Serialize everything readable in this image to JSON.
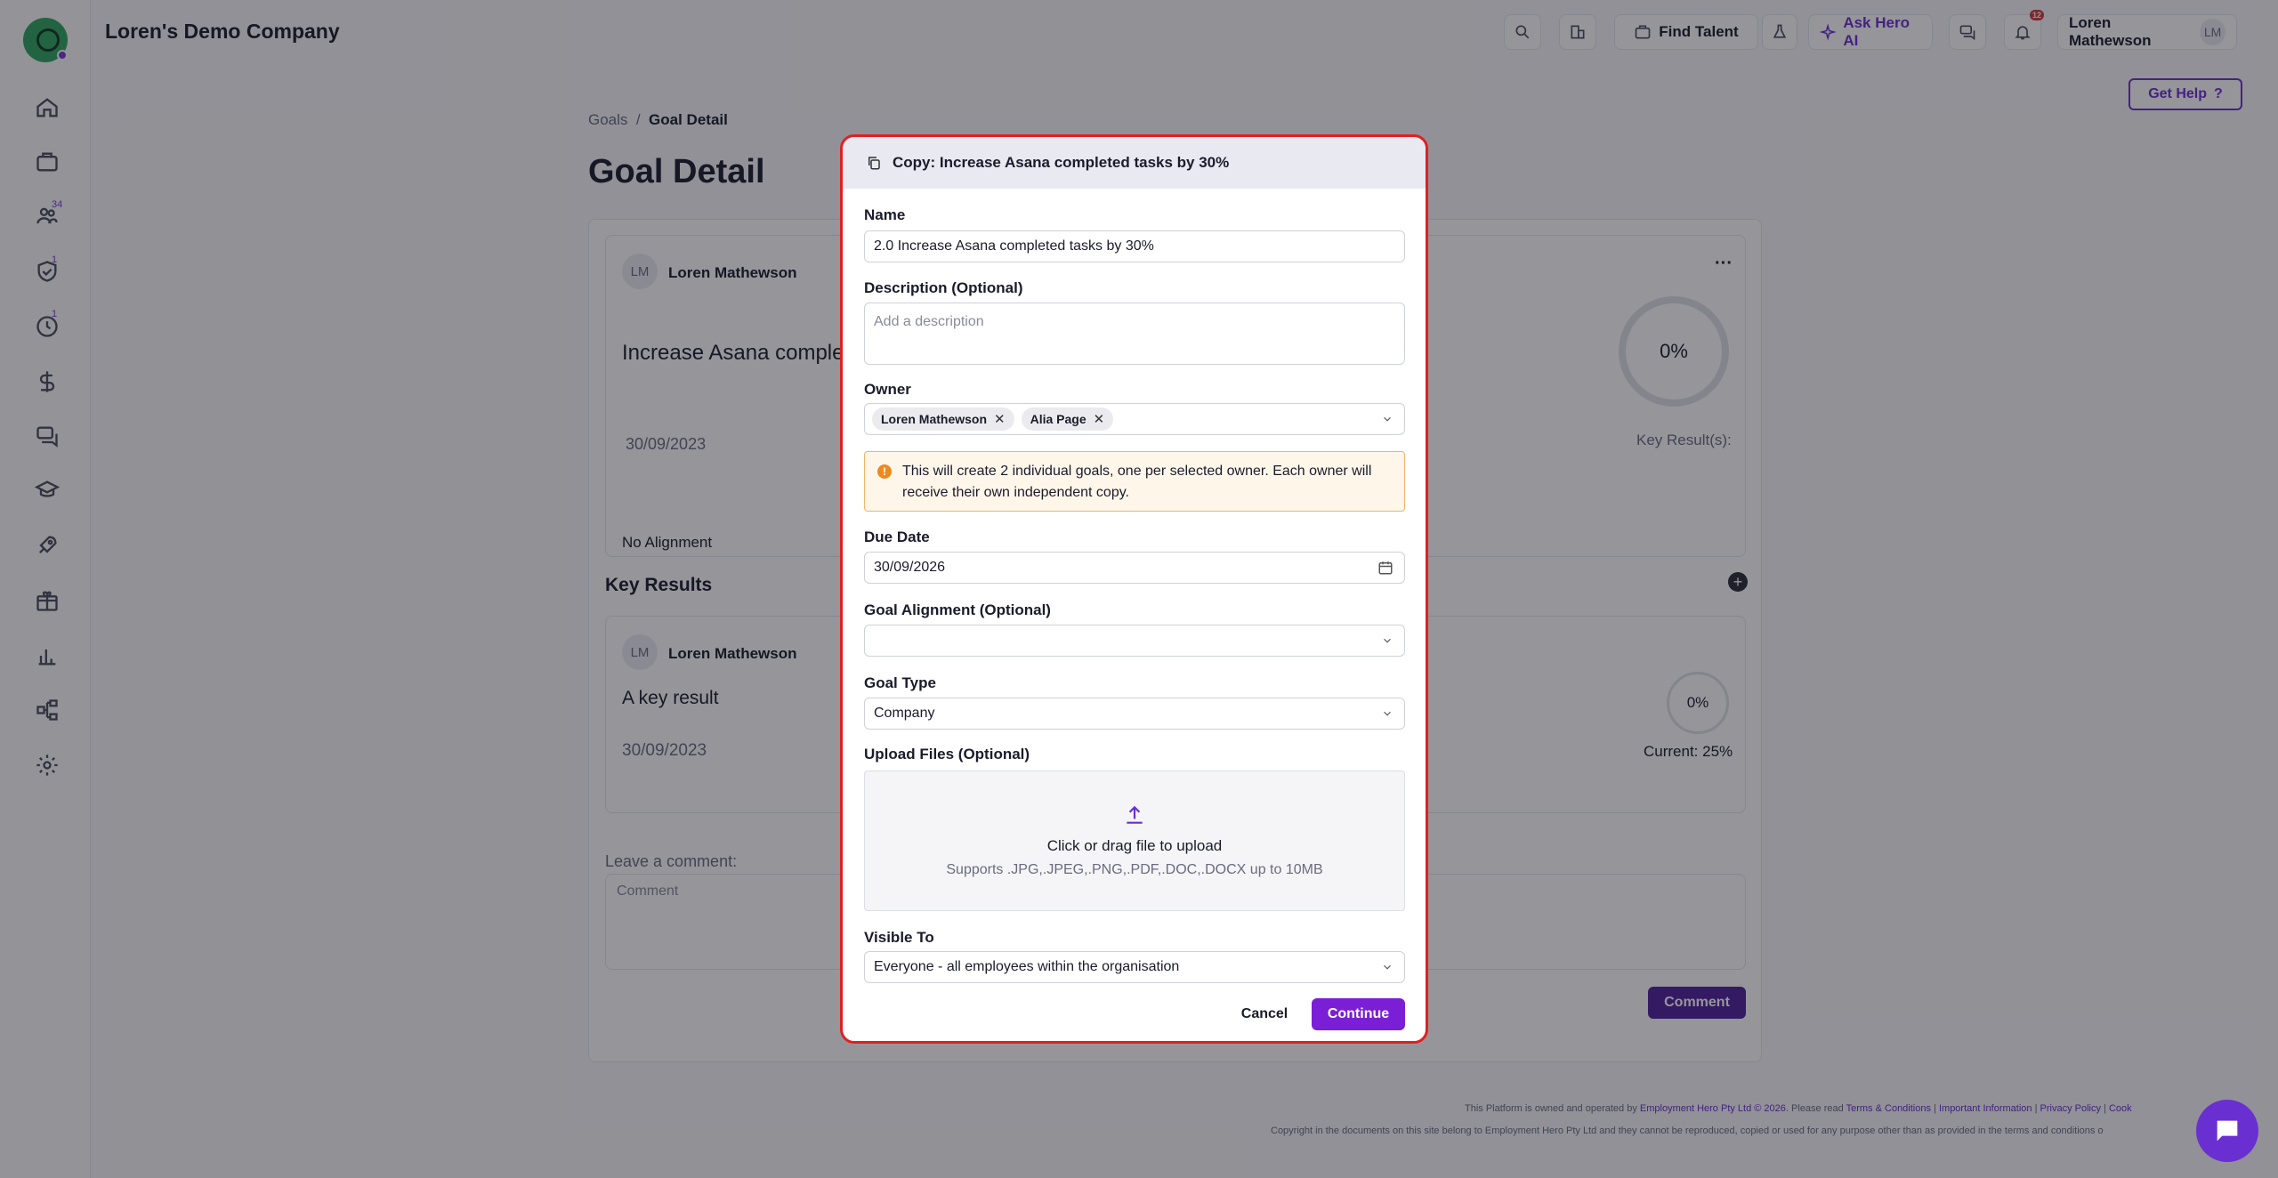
{
  "header": {
    "company": "Loren's Demo Company",
    "find_talent": "Find Talent",
    "ask_ai": "Ask Hero AI",
    "user_name": "Loren Mathewson",
    "user_initials": "LM",
    "notification_count": "12",
    "get_help": "Get Help"
  },
  "sidebar": {
    "badges": {
      "people": "34",
      "compliance": "1",
      "time": "1"
    }
  },
  "page": {
    "breadcrumb_parent": "Goals",
    "breadcrumb_current": "Goal Detail",
    "title": "Goal Detail",
    "goal_owner": "Loren Mathewson",
    "goal_title": "Increase Asana comple",
    "goal_due": "30/09/2023",
    "goal_progress": "0%",
    "key_results_label": "Key Result(s):",
    "alignment": "No Alignment",
    "kr_section": "Key Results",
    "kr_owner": "Loren Mathewson",
    "kr_title": "A key result",
    "kr_due": "30/09/2023",
    "kr_progress": "0%",
    "kr_current": "Current: 25%",
    "comment_label": "Leave a comment:",
    "comment_placeholder": "Comment",
    "comment_button": "Comment"
  },
  "modal": {
    "title": "Copy: Increase Asana completed tasks by 30%",
    "name_label": "Name",
    "name_value": "2.0 Increase Asana completed tasks by 30%",
    "desc_label": "Description (Optional)",
    "desc_placeholder": "Add a description",
    "owner_label": "Owner",
    "owners": [
      "Loren Mathewson",
      "Alia Page"
    ],
    "warning": "This will create 2 individual goals, one per selected owner. Each owner will receive their own independent copy.",
    "due_label": "Due Date",
    "due_value": "30/09/2026",
    "alignment_label": "Goal Alignment (Optional)",
    "alignment_value": "",
    "type_label": "Goal Type",
    "type_value": "Company",
    "upload_label": "Upload Files (Optional)",
    "upload_main": "Click or drag file to upload",
    "upload_sub": "Supports .JPG,.JPEG,.PNG,.PDF,.DOC,.DOCX up to 10MB",
    "visible_label": "Visible To",
    "visible_value": "Everyone - all employees within the organisation",
    "cancel": "Cancel",
    "continue": "Continue"
  },
  "footer": {
    "line1_prefix": "This Platform is owned and operated by ",
    "line1_company": "Employment Hero Pty Ltd © 2026",
    "line1_mid": ". Please read ",
    "terms": "Terms & Conditions",
    "important": "Important Information",
    "privacy": "Privacy Policy",
    "cookies": "Cook",
    "line2": "Copyright in the documents on this site belong to Employment Hero Pty Ltd and they cannot be reproduced, copied or used for any purpose other than as provided in the terms and conditions o"
  }
}
